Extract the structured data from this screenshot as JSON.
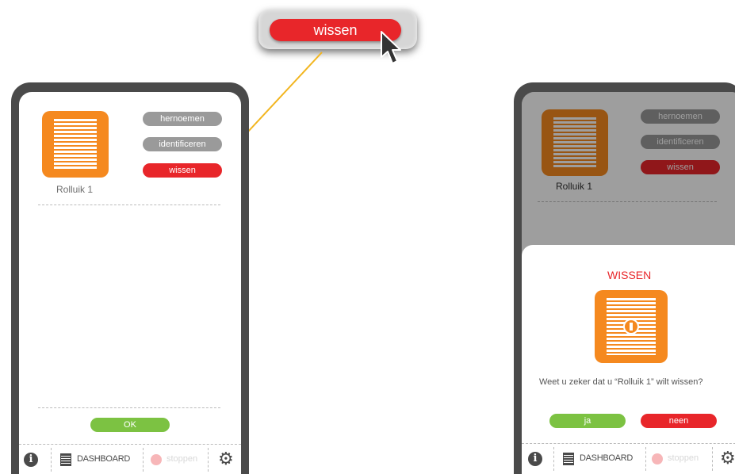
{
  "zoom": {
    "button_label": "wissen"
  },
  "left_screen": {
    "device_name": "Rolluik 1",
    "actions": [
      {
        "label": "hernoemen"
      },
      {
        "label": "identificeren"
      },
      {
        "label": "wissen"
      }
    ],
    "ok_label": "OK"
  },
  "right_screen": {
    "device_name": "Rolluik 1",
    "actions": [
      {
        "label": "hernoemen"
      },
      {
        "label": "identificeren"
      },
      {
        "label": "wissen"
      }
    ],
    "dialog": {
      "title": "WISSEN",
      "message": "Weet u zeker dat u “Rolluik 1” wilt wissen?",
      "yes_label": "ja",
      "no_label": "neen"
    }
  },
  "bottom_bar": {
    "info_icon": "i",
    "dashboard_label": "DASHBOARD",
    "stop_label": "stoppen",
    "gear_icon": "⚙"
  },
  "colors": {
    "accent_orange": "#f5891f",
    "danger_red": "#e8262a",
    "ok_green": "#7cc242",
    "frame_dark": "#4a4a4a",
    "pill_grey": "#9a9a9a",
    "connector_yellow": "#f2b51f"
  }
}
